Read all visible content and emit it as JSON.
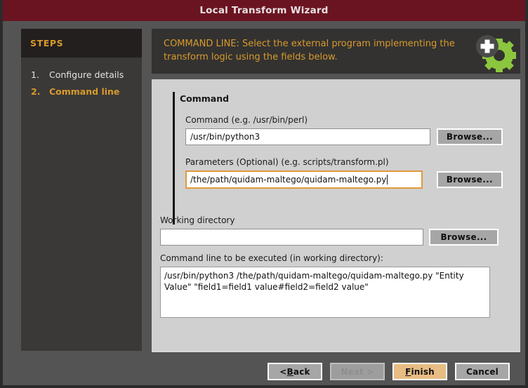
{
  "window": {
    "title": "Local Transform Wizard"
  },
  "sidebar": {
    "header": "STEPS",
    "steps": [
      {
        "number": "1.",
        "label": "Configure details",
        "state": "inactive"
      },
      {
        "number": "2.",
        "label": "Command line",
        "state": "active"
      }
    ]
  },
  "banner": {
    "text": "COMMAND LINE: Select the external program implementing the transform logic using the fields below.",
    "icon": "gear-plus-icon",
    "text_color": "#d99a2b",
    "gear_color": "#8cc63e"
  },
  "form": {
    "group_title": "Command",
    "command": {
      "label": "Command (e.g. /usr/bin/perl)",
      "value": "/usr/bin/python3",
      "browse_label": "Browse..."
    },
    "parameters": {
      "label": "Parameters (Optional) (e.g. scripts/transform.pl)",
      "value": "/the/path/quidam-maltego/quidam-maltego.py",
      "browse_label": "Browse...",
      "focused": true
    },
    "working_directory": {
      "label": "Working directory",
      "value": "",
      "browse_label": "Browse..."
    },
    "command_line_preview": {
      "label": "Command line to be executed (in working directory):",
      "value": "/usr/bin/python3 /the/path/quidam-maltego/quidam-maltego.py \"Entity Value\" \"field1=field1 value#field2=field2 value\""
    }
  },
  "footer": {
    "back": {
      "pre": "< ",
      "accel": "B",
      "post": "ack"
    },
    "next": {
      "label": "Next >"
    },
    "finish": {
      "accel": "F",
      "post": "inish"
    },
    "cancel": {
      "label": "Cancel"
    }
  },
  "colors": {
    "titlebar": "#6b1421",
    "window_bg": "#545454",
    "sidebar_bg": "#3a3937",
    "sidebar_header_bg": "#221f1e",
    "panel_bg": "#d0d0d0",
    "accent_orange": "#d99a2b",
    "focus_border": "#e09a3c",
    "primary_button": "#e8bd83"
  }
}
